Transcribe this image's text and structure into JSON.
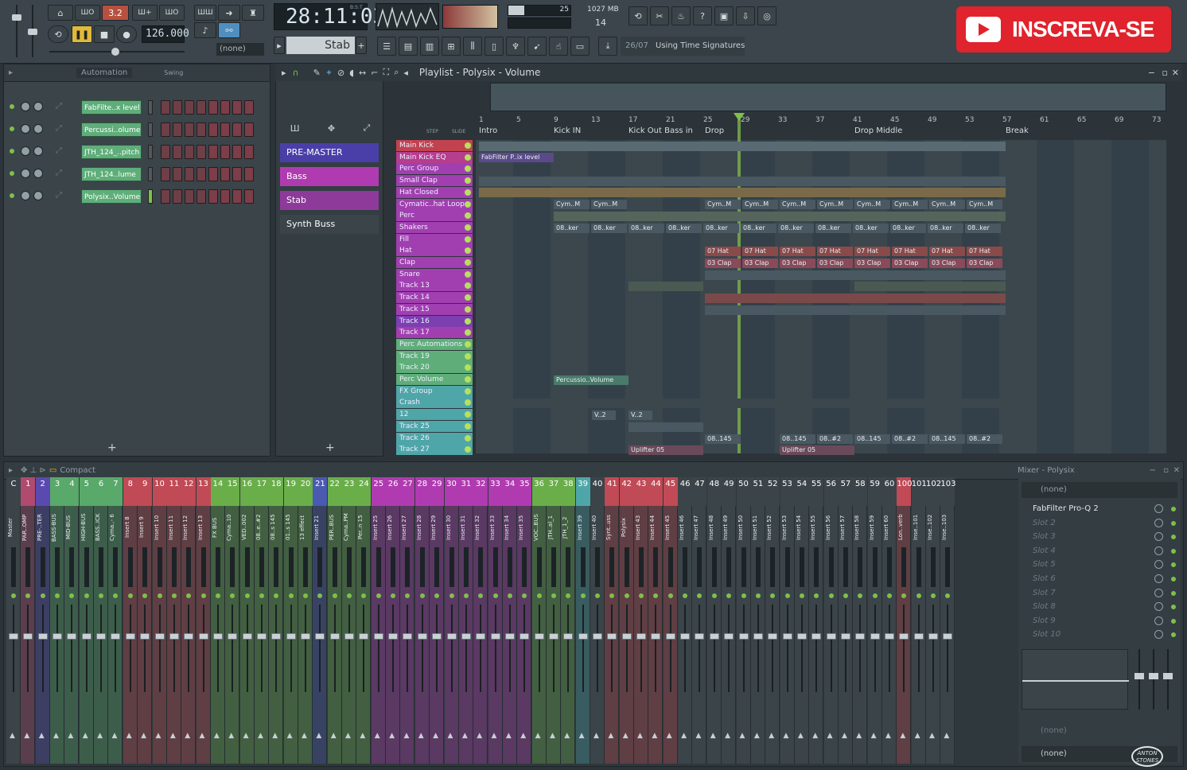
{
  "toolbar": {
    "time": "28:11:03",
    "time_label": "B:S:T",
    "tempo": "126.000",
    "pattern_name": "Stab",
    "cpu_value": "25",
    "ram": "1027 MB",
    "voices": "14",
    "pattern_none": "(none)",
    "hint_index": "26/07",
    "hint_text": "Using Time Signatures",
    "mode_label": "3.2"
  },
  "subscribe": {
    "label": "INSCREVA-SE"
  },
  "channel_rack": {
    "header_label": "Automation",
    "swing_label": "Swing",
    "channels": [
      {
        "name": "FabFilte..x level"
      },
      {
        "name": "Percussi..olume"
      },
      {
        "name": "JTH_124_..pitch"
      },
      {
        "name": "JTH_124..lume"
      },
      {
        "name": "Polysix..Volume"
      }
    ],
    "add_symbol": "+"
  },
  "browser": {
    "items": [
      {
        "label": "PRE-MASTER",
        "color": "#4a3fa8"
      },
      {
        "label": "Bass",
        "color": "#b03bb0"
      },
      {
        "label": "Stab",
        "color": "#8d3a9a"
      },
      {
        "label": "Synth Buss",
        "color": "#3a4449"
      }
    ],
    "add_symbol": "+"
  },
  "playlist": {
    "title": "Playlist - Polysix - Volume",
    "step_label": "STEP",
    "slide_label": "SLIDE",
    "ruler": [
      "1",
      "5",
      "9",
      "13",
      "17",
      "21",
      "25",
      "29",
      "33",
      "37",
      "41",
      "45",
      "49",
      "53",
      "57",
      "61",
      "65",
      "69",
      "73"
    ],
    "markers": [
      {
        "label": "Intro"
      },
      {
        "label": "Kick IN"
      },
      {
        "label": "Kick Out Bass in"
      },
      {
        "label": "Drop"
      },
      {
        "label": "Drop Middle"
      },
      {
        "label": "Break"
      }
    ],
    "tracks": [
      {
        "name": "Main Kick",
        "color": "#c0434f"
      },
      {
        "name": "Main Kick EQ",
        "color": "#b53e8e"
      },
      {
        "name": "Perc Group",
        "color": "#a13fb0"
      },
      {
        "name": "Small Clap",
        "color": "#a13fb0"
      },
      {
        "name": "Hat Closed",
        "color": "#a13fb0"
      },
      {
        "name": "Cymatic..hat Loop",
        "color": "#a13fb0"
      },
      {
        "name": "Perc",
        "color": "#a13fb0"
      },
      {
        "name": "Shakers",
        "color": "#a13fb0"
      },
      {
        "name": "Fill",
        "color": "#a13fb0"
      },
      {
        "name": "Hat",
        "color": "#a13fb0"
      },
      {
        "name": "Clap",
        "color": "#a13fb0"
      },
      {
        "name": "Snare",
        "color": "#a13fb0"
      },
      {
        "name": "Track 13",
        "color": "#a13fb0"
      },
      {
        "name": "Track 14",
        "color": "#a13fb0"
      },
      {
        "name": "Track 15",
        "color": "#a13fb0"
      },
      {
        "name": "Track 16",
        "color": "#7b3fb0"
      },
      {
        "name": "Track 17",
        "color": "#a13fb0"
      },
      {
        "name": "Perc Automations",
        "color": "#5fae7a"
      },
      {
        "name": "Track 19",
        "color": "#5fae7a"
      },
      {
        "name": "Track 20",
        "color": "#5fae7a"
      },
      {
        "name": "Perc Volume",
        "color": "#5fae7a"
      },
      {
        "name": "FX Group",
        "color": "#4fa6a8"
      },
      {
        "name": "Crash",
        "color": "#4fa6a8"
      },
      {
        "name": "12",
        "color": "#4fa6a8"
      },
      {
        "name": "Track 25",
        "color": "#4fa6a8"
      },
      {
        "name": "Track 26",
        "color": "#4fa6a8"
      },
      {
        "name": "Track 27",
        "color": "#4fa6a8"
      }
    ],
    "clips": {
      "fabfilter": "FabFilter P..ix level",
      "cym": "Cym..M",
      "shaker": "08..ker",
      "hat": "07 Hat",
      "clap": "03 Clap",
      "perc_volume": "Percussio..Volume",
      "v2": "V..2",
      "fx145": "08..145",
      "fx2": "08..#2",
      "uplifter": "Uplifter 05"
    }
  },
  "mixer": {
    "compact_label": "Compact",
    "title": "Mixer - Polysix",
    "none_label": "(none)",
    "slots": [
      {
        "label": "FabFilter Pro-Q 2",
        "active": true
      },
      {
        "label": "Slot 2"
      },
      {
        "label": "Slot 3"
      },
      {
        "label": "Slot 4"
      },
      {
        "label": "Slot 5"
      },
      {
        "label": "Slot 6"
      },
      {
        "label": "Slot 7"
      },
      {
        "label": "Slot 8"
      },
      {
        "label": "Slot 9"
      },
      {
        "label": "Slot 10"
      }
    ],
    "bottom_none_1": "(none)",
    "bottom_none_2": "(none)",
    "channels": [
      {
        "num": "C",
        "label": "Master",
        "color": "#3a4449"
      },
      {
        "num": "1",
        "label": "PAR..OMP",
        "color": "#b04a6e"
      },
      {
        "num": "2",
        "label": "PRE-..TER",
        "color": "#5a4ab0"
      },
      {
        "num": "3",
        "label": "BASS-BUS",
        "color": "#59a96a"
      },
      {
        "num": "4",
        "label": "MID-BUS",
        "color": "#59a96a"
      },
      {
        "num": "5",
        "label": "HIGH-BUS",
        "color": "#59a96a"
      },
      {
        "num": "6",
        "label": "BASS..ICK",
        "color": "#59a96a"
      },
      {
        "num": "7",
        "label": "Cyma..- 6",
        "color": "#59a96a"
      },
      {
        "num": "8",
        "label": "Insert 8",
        "color": "#c04a55"
      },
      {
        "num": "9",
        "label": "Insert 9",
        "color": "#c04a55"
      },
      {
        "num": "10",
        "label": "Insert 10",
        "color": "#c04a55"
      },
      {
        "num": "11",
        "label": "Insert 11",
        "color": "#c04a55"
      },
      {
        "num": "12",
        "label": "Insert 12",
        "color": "#c04a55"
      },
      {
        "num": "13",
        "label": "Insert 13",
        "color": "#c04a55"
      },
      {
        "num": "14",
        "label": "FX BUS",
        "color": "#6aae4a"
      },
      {
        "num": "15",
        "label": "Cyma..10",
        "color": "#6aae4a"
      },
      {
        "num": "16",
        "label": "VED..002",
        "color": "#6aae4a"
      },
      {
        "num": "17",
        "label": "08..e..#2",
        "color": "#6aae4a"
      },
      {
        "num": "18",
        "label": "08..s 145",
        "color": "#6aae4a"
      },
      {
        "num": "19",
        "label": "01..s 145",
        "color": "#6aae4a"
      },
      {
        "num": "20",
        "label": "13 effect",
        "color": "#6aae4a"
      },
      {
        "num": "21",
        "label": "Insert 21",
        "color": "#4a5ab0"
      },
      {
        "num": "22",
        "label": "PER..BUS",
        "color": "#6aae4a"
      },
      {
        "num": "23",
        "label": "Cyma..PM",
        "color": "#6aae4a"
      },
      {
        "num": "24",
        "label": "Per..n 15",
        "color": "#6aae4a"
      },
      {
        "num": "25",
        "label": "Insert 25",
        "color": "#b03bb0"
      },
      {
        "num": "26",
        "label": "Insert 26",
        "color": "#b03bb0"
      },
      {
        "num": "27",
        "label": "Insert 27",
        "color": "#b03bb0"
      },
      {
        "num": "28",
        "label": "Insert 28",
        "color": "#b03bb0"
      },
      {
        "num": "29",
        "label": "Insert 29",
        "color": "#b03bb0"
      },
      {
        "num": "30",
        "label": "Insert 30",
        "color": "#b03bb0"
      },
      {
        "num": "31",
        "label": "Insert 31",
        "color": "#b03bb0"
      },
      {
        "num": "32",
        "label": "Insert 32",
        "color": "#b03bb0"
      },
      {
        "num": "33",
        "label": "Insert 33",
        "color": "#b03bb0"
      },
      {
        "num": "34",
        "label": "Insert 34",
        "color": "#b03bb0"
      },
      {
        "num": "35",
        "label": "Insert 35",
        "color": "#b03bb0"
      },
      {
        "num": "36",
        "label": "VOC..BUS",
        "color": "#6aae4a"
      },
      {
        "num": "37",
        "label": "JTH..al_1",
        "color": "#6aae4a"
      },
      {
        "num": "38",
        "label": "JTH_1_2",
        "color": "#6aae4a"
      },
      {
        "num": "39",
        "label": "Insert 39",
        "color": "#4fa6a8"
      },
      {
        "num": "40",
        "label": "Insert 40",
        "color": "#3a4449"
      },
      {
        "num": "41",
        "label": "Synt..uss",
        "color": "#c04a55"
      },
      {
        "num": "42",
        "label": "Polysix",
        "color": "#c04a55"
      },
      {
        "num": "43",
        "label": "Insert 43",
        "color": "#c04a55"
      },
      {
        "num": "44",
        "label": "Insert 44",
        "color": "#c04a55"
      },
      {
        "num": "45",
        "label": "Insert 45",
        "color": "#c04a55"
      },
      {
        "num": "46",
        "label": "Insert 46",
        "color": "#3a4449"
      },
      {
        "num": "47",
        "label": "Insert 47",
        "color": "#3a4449"
      },
      {
        "num": "48",
        "label": "Insert 48",
        "color": "#3a4449"
      },
      {
        "num": "49",
        "label": "Insert 49",
        "color": "#3a4449"
      },
      {
        "num": "50",
        "label": "Insert 50",
        "color": "#3a4449"
      },
      {
        "num": "51",
        "label": "Insert 51",
        "color": "#3a4449"
      },
      {
        "num": "52",
        "label": "Insert 52",
        "color": "#3a4449"
      },
      {
        "num": "53",
        "label": "Insert 53",
        "color": "#3a4449"
      },
      {
        "num": "54",
        "label": "Insert 54",
        "color": "#3a4449"
      },
      {
        "num": "55",
        "label": "Insert 55",
        "color": "#3a4449"
      },
      {
        "num": "56",
        "label": "Insert 56",
        "color": "#3a4449"
      },
      {
        "num": "57",
        "label": "Insert 57",
        "color": "#3a4449"
      },
      {
        "num": "58",
        "label": "Insert 58",
        "color": "#3a4449"
      },
      {
        "num": "59",
        "label": "Insert 59",
        "color": "#3a4449"
      },
      {
        "num": "60",
        "label": "Insert 60",
        "color": "#3a4449"
      },
      {
        "num": "100",
        "label": "Lon..verb",
        "color": "#c04a55"
      },
      {
        "num": "101",
        "label": "Inse..101",
        "color": "#3a4449"
      },
      {
        "num": "102",
        "label": "Inse..102",
        "color": "#3a4449"
      },
      {
        "num": "103",
        "label": "Inse..103",
        "color": "#3a4449"
      }
    ]
  },
  "watermark": {
    "text": "ANTON STONES"
  }
}
